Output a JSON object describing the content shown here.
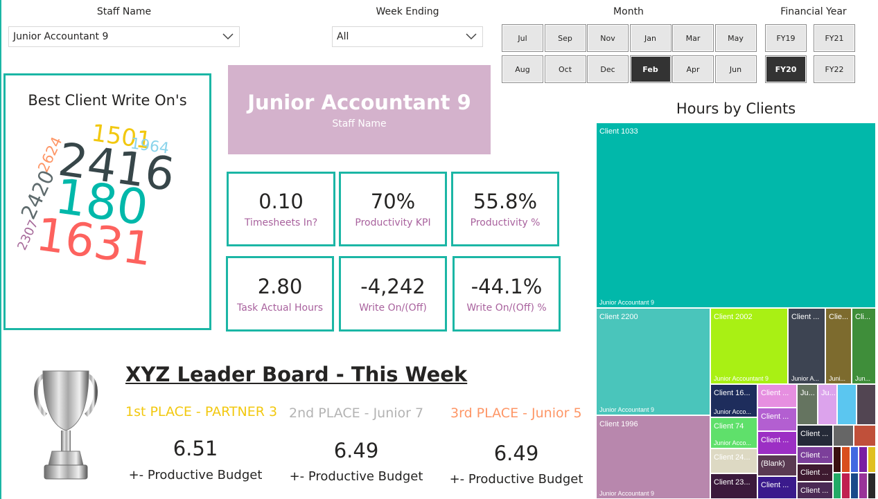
{
  "slicers": {
    "staff_name": {
      "title": "Staff Name",
      "value": "Junior Accountant 9"
    },
    "week_ending": {
      "title": "Week Ending",
      "value": "All"
    },
    "month": {
      "title": "Month",
      "row1": [
        "Jul",
        "Sep",
        "Nov",
        "Jan",
        "Mar",
        "May"
      ],
      "row2": [
        "Aug",
        "Oct",
        "Dec",
        "Feb",
        "Apr",
        "Jun"
      ],
      "selected": "Feb"
    },
    "financial_year": {
      "title": "Financial Year",
      "row1": [
        "FY19",
        "FY21"
      ],
      "row2": [
        "FY20",
        "FY22"
      ],
      "selected": "FY20"
    }
  },
  "word_cloud": {
    "title": "Best Client Write On's",
    "words": [
      {
        "text": "1501",
        "color": "#f2c80f"
      },
      {
        "text": "1964",
        "color": "#8ad4eb"
      },
      {
        "text": "2624",
        "color": "#fe9666"
      },
      {
        "text": "2416",
        "color": "#374649"
      },
      {
        "text": "2420",
        "color": "#5f6b6d"
      },
      {
        "text": "180",
        "color": "#01b8aa"
      },
      {
        "text": "2307",
        "color": "#a66999"
      },
      {
        "text": "1631",
        "color": "#fd625e"
      }
    ]
  },
  "staff_card": {
    "value": "Junior Accountant 9",
    "label": "Staff Name",
    "bg": "#d4b2cc"
  },
  "kpis": [
    {
      "value": "0.10",
      "label": "Timesheets In?"
    },
    {
      "value": "70%",
      "label": "Productivity KPI"
    },
    {
      "value": "55.8%",
      "label": "Productivity %"
    },
    {
      "value": "2.80",
      "label": "Task Actual Hours"
    },
    {
      "value": "-4,242",
      "label": "Write On/(Off)"
    },
    {
      "value": "-44.1%",
      "label": "Write On/(Off) %"
    }
  ],
  "leader_board": {
    "title": "XYZ Leader Board - This Week",
    "places": [
      {
        "label": "1st PLACE - PARTNER 3",
        "score": "6.51",
        "sub": "+- Productive Budget",
        "color": "#f2c80f"
      },
      {
        "label": "2nd PLACE - Junior 7",
        "score": "6.49",
        "sub": "+- Productive Budget",
        "color": "#b3b3b3"
      },
      {
        "label": "3rd PLACE - Junior 5",
        "score": "6.49",
        "sub": "+- Productive Budget",
        "color": "#fe9666"
      }
    ]
  },
  "treemap": {
    "title": "Hours by Clients",
    "tiles": [
      {
        "client": "Client 1033",
        "staff": "Junior Accountant 9",
        "color": "#01b8aa"
      },
      {
        "client": "Client 2200",
        "staff": "Junior Accountant 9",
        "color": "#4ac5bb"
      },
      {
        "client": "Client 1996",
        "staff": "Junior Accountant 9",
        "color": "#b887ad"
      },
      {
        "client": "Client 2002",
        "staff": "Junior Accountant 9",
        "color": "#a9f014"
      },
      {
        "client": "Client ...",
        "staff": "Junior A...",
        "color": "#3d4452"
      },
      {
        "client": "Clie...",
        "staff": "Juni...",
        "color": "#7d6b2e"
      },
      {
        "client": "Cli...",
        "staff": "Jun...",
        "color": "#3f8e3a"
      },
      {
        "client": "Client 16...",
        "staff": "Junior Acco...",
        "color": "#1e2d5c"
      },
      {
        "client": "Client 74",
        "staff": "Junior Acco...",
        "color": "#5fe06b"
      },
      {
        "client": "Client 24...",
        "staff": "",
        "color": "#ddd9c3"
      },
      {
        "client": "Client 23...",
        "staff": "",
        "color": "#3b1a3c"
      },
      {
        "client": "Client ...",
        "staff": "",
        "color": "#e68fe0"
      },
      {
        "client": "Client ...",
        "staff": "",
        "color": "#b35fd1"
      },
      {
        "client": "Client ...",
        "staff": "",
        "color": "#9c2fc4"
      },
      {
        "client": "(Blank)",
        "staff": "",
        "color": "#5a3a52"
      },
      {
        "client": "Client ...",
        "staff": "",
        "color": "#3a1a8c"
      },
      {
        "client": "Ju...",
        "staff": "",
        "color": "#657460"
      },
      {
        "client": "Ju...",
        "staff": "",
        "color": "#dca3ec"
      },
      {
        "client": "",
        "staff": "",
        "color": "#5bc6f0"
      },
      {
        "client": "",
        "staff": "",
        "color": "#524552"
      },
      {
        "client": "Client ...",
        "staff": "",
        "color": "#252a38"
      },
      {
        "client": "",
        "staff": "",
        "color": "#666666"
      },
      {
        "client": "",
        "staff": "",
        "color": "#c0503a"
      },
      {
        "client": "Client ...",
        "staff": "",
        "color": "#7c3f9a"
      },
      {
        "client": "Client ...",
        "staff": "",
        "color": "#3e1a30"
      },
      {
        "client": "Client ...",
        "staff": "",
        "color": "#4a2a55"
      }
    ]
  }
}
